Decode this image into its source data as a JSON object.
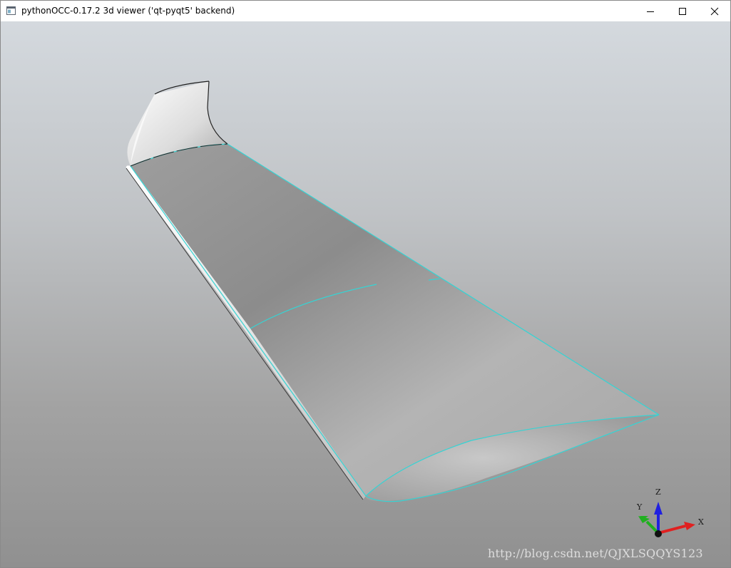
{
  "window": {
    "title": "pythonOCC-0.17.2 3d viewer ('qt-pyqt5' backend)",
    "controls": {
      "minimize": "minimize-icon",
      "maximize": "maximize-icon",
      "close": "close-icon"
    }
  },
  "viewer": {
    "background_top": "#d4d9de",
    "background_bottom": "#909090",
    "model": "wing",
    "edge_color": "#35d4d4",
    "triedron": {
      "x_label": "X",
      "y_label": "Y",
      "z_label": "Z",
      "x_color": "#e02020",
      "y_color": "#20b020",
      "z_color": "#2020e0"
    }
  },
  "watermark": "http://blog.csdn.net/QJXLSQQYS123"
}
